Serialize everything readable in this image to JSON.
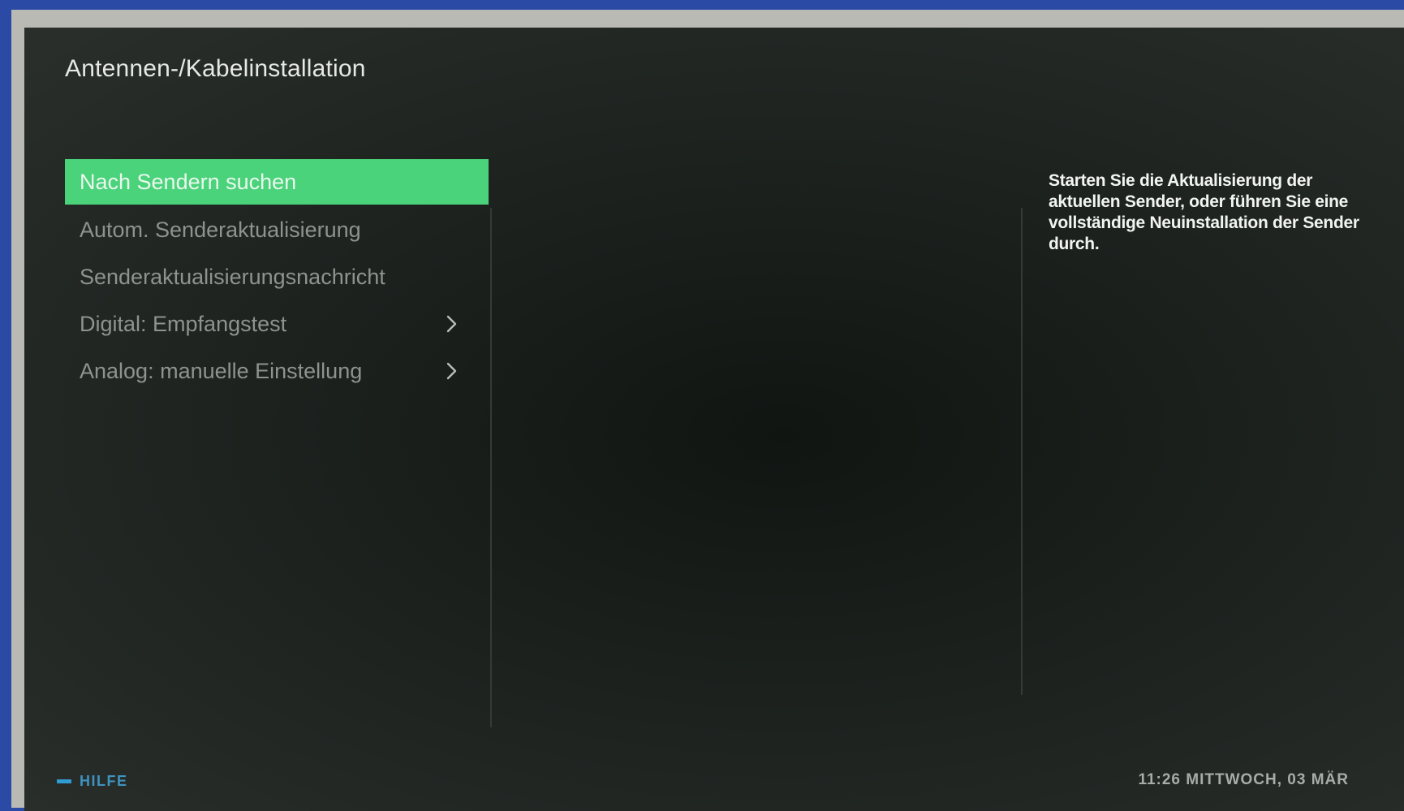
{
  "header": {
    "title": "Antennen-/Kabelinstallation"
  },
  "menu": {
    "items": [
      {
        "label": "Nach Sendern suchen",
        "selected": true,
        "has_submenu": false
      },
      {
        "label": "Autom. Senderaktualisierung",
        "selected": false,
        "has_submenu": false
      },
      {
        "label": "Senderaktualisierungsnachricht",
        "selected": false,
        "has_submenu": false
      },
      {
        "label": "Digital: Empfangstest",
        "selected": false,
        "has_submenu": true,
        "icon": "chevron-right-icon"
      },
      {
        "label": "Analog: manuelle Einstellung",
        "selected": false,
        "has_submenu": true,
        "icon": "chevron-right-icon"
      }
    ]
  },
  "help_panel": {
    "text": "Starten Sie die Aktualisierung der aktuellen Sender, oder führen Sie eine vollständige Neuinstallation der Sender durch."
  },
  "footer": {
    "hint_icon": "minus-icon",
    "hint_label": "HILFE",
    "datetime": "11:26 MITTWOCH, 03 MÄR"
  },
  "colors": {
    "selection": "#4ad37a",
    "hint_blue": "#2f9cd4",
    "background": "#1a1f1c"
  }
}
